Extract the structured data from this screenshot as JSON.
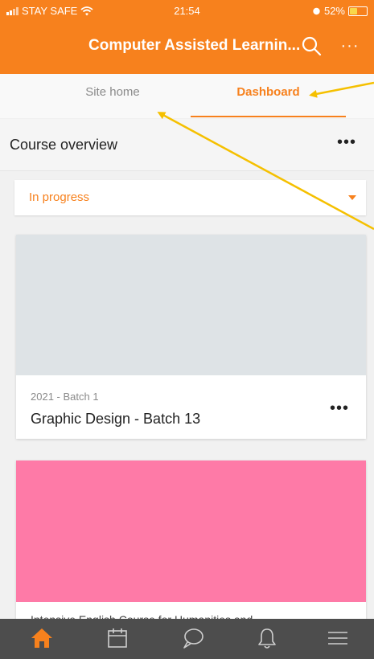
{
  "status_bar": {
    "carrier": "STAY SAFE",
    "time": "21:54",
    "battery": "52%",
    "battery_level": 0.52
  },
  "header": {
    "title": "Computer Assisted Learnin...",
    "search_icon": "search-icon",
    "more_icon": "more-horizontal-icon",
    "more_label": "···"
  },
  "tabs": [
    {
      "label": "Site home",
      "active": false
    },
    {
      "label": "Dashboard",
      "active": true
    }
  ],
  "course_overview": {
    "title": "Course overview",
    "more_label": "•••",
    "filter_value": "In progress"
  },
  "courses": [
    {
      "category": "2021 - Batch 1",
      "name": "Graphic Design - Batch 13",
      "image_color": "#dee3e6",
      "more_label": "•••"
    },
    {
      "name": "Intensive English Course for Humanities and",
      "image_color": "#fe7aa7"
    }
  ],
  "bottom_nav": [
    {
      "icon": "home-icon",
      "active": true
    },
    {
      "icon": "calendar-icon",
      "active": false
    },
    {
      "icon": "messages-icon",
      "active": false
    },
    {
      "icon": "notifications-icon",
      "active": false
    },
    {
      "icon": "menu-icon",
      "active": false
    }
  ],
  "colors": {
    "brand": "#f7811d",
    "annotation_arrow": "#f5c000",
    "nav_bg": "#4d4d4d",
    "nav_inactive": "#cfcfcf"
  }
}
